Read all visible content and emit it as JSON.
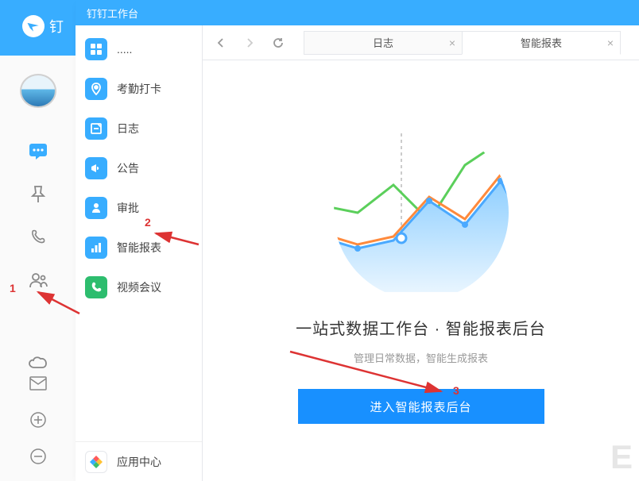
{
  "app": {
    "title": "钉钉工作台",
    "brand_text": "钉"
  },
  "rail": {
    "avatar": true
  },
  "panel": {
    "items": [
      {
        "label": ".....",
        "icon": "grid"
      },
      {
        "label": "考勤打卡",
        "icon": "location"
      },
      {
        "label": "日志",
        "icon": "note"
      },
      {
        "label": "公告",
        "icon": "megaphone"
      },
      {
        "label": "审批",
        "icon": "user-check"
      },
      {
        "label": "智能报表",
        "icon": "bar-chart"
      },
      {
        "label": "视频会议",
        "icon": "phone"
      }
    ],
    "footer_label": "应用中心"
  },
  "tabs": [
    {
      "label": "日志",
      "active": false
    },
    {
      "label": "智能报表",
      "active": true
    }
  ],
  "main": {
    "headline": "一站式数据工作台 · 智能报表后台",
    "subline": "管理日常数据，智能生成报表",
    "cta_label": "进入智能报表后台"
  },
  "annotations": {
    "n1": "1",
    "n2": "2",
    "n3": "3"
  },
  "watermark": "E",
  "chart_data": {
    "type": "line",
    "note": "decorative illustration, approximate shapes only",
    "series": [
      {
        "name": "green",
        "color": "#5bcf5b",
        "values": [
          60,
          55,
          75,
          45,
          90,
          110,
          75
        ]
      },
      {
        "name": "orange",
        "color": "#ff8a3d",
        "values": [
          40,
          30,
          35,
          70,
          50,
          92,
          38
        ]
      },
      {
        "name": "blue-area",
        "color": "#4aa9ff",
        "values": [
          35,
          25,
          30,
          65,
          45,
          88,
          30
        ]
      }
    ],
    "x": [
      0,
      1,
      2,
      3,
      4,
      5,
      6
    ],
    "clip": "circle"
  }
}
